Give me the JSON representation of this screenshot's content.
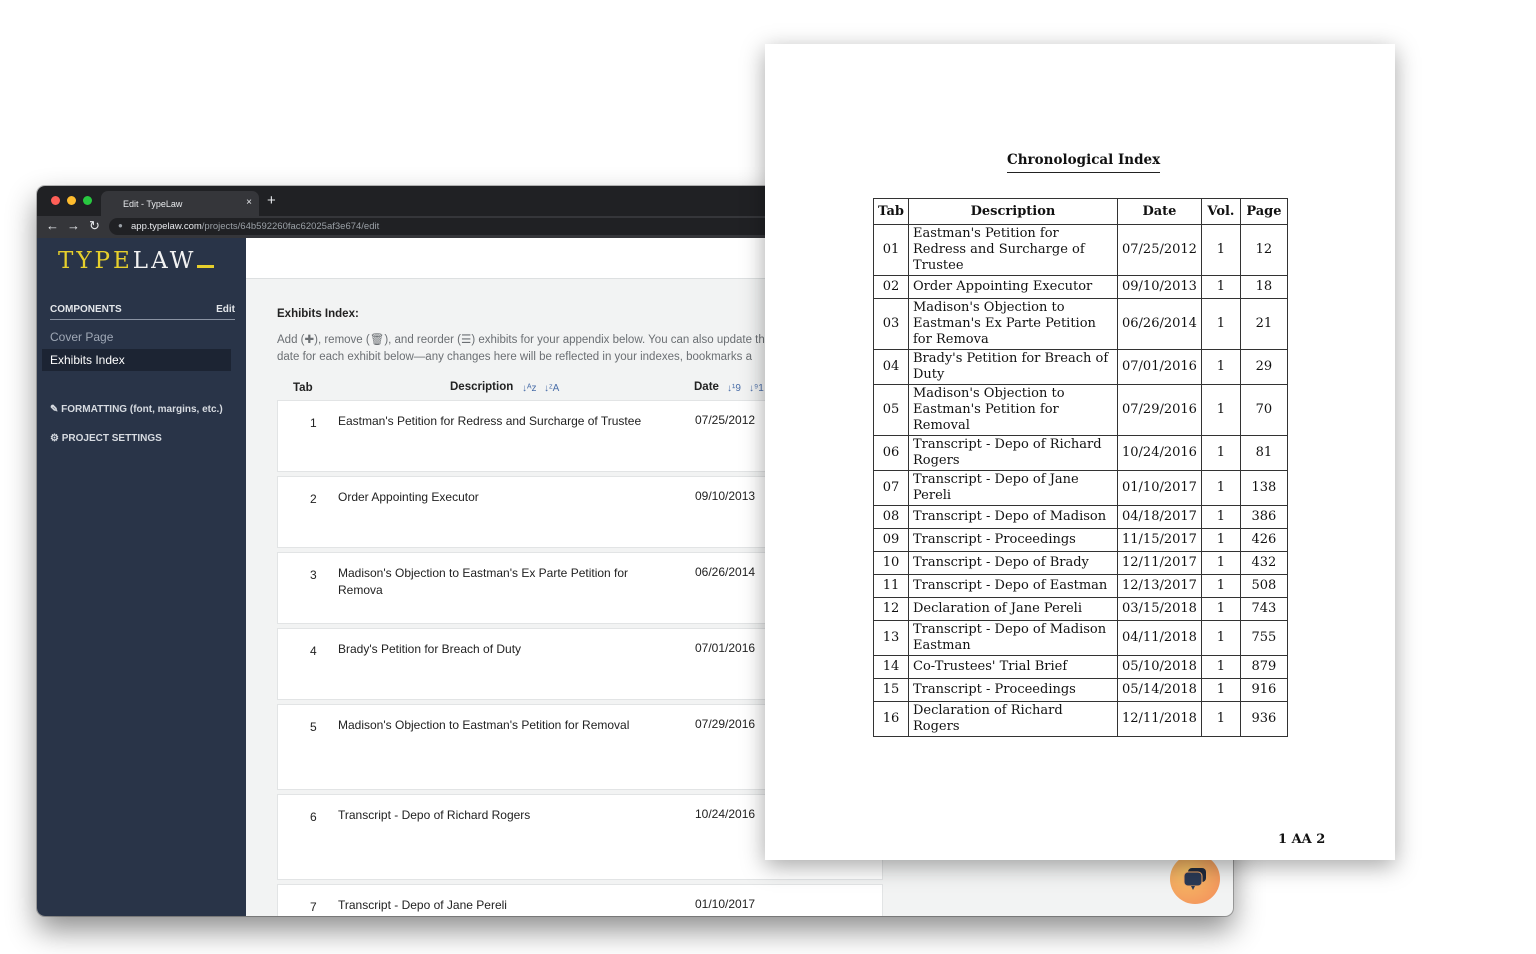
{
  "browser": {
    "tab_title": "Edit - TypeLaw",
    "tab_close": "×",
    "new_tab": "+",
    "url_host": "app.typelaw.com",
    "url_path": "/projects/64b592260fac62025af3e674/edit",
    "nav": {
      "back": "←",
      "forward": "→",
      "reload": "↻",
      "lock": "🔒"
    }
  },
  "sidebar": {
    "logo_type": "TYPE",
    "logo_law": "LAW",
    "components_label": "COMPONENTS",
    "edit_label": "Edit",
    "items": [
      {
        "label": "Cover Page",
        "active": false
      },
      {
        "label": "Exhibits Index",
        "active": true
      }
    ],
    "formatting_label": "FORMATTING (font, margins, etc.)",
    "project_settings_label": "PROJECT SETTINGS",
    "formatting_icon": "✎",
    "settings_icon": "⚙"
  },
  "main": {
    "title": "Exhibits Index:",
    "desc_line1": "Add (✚), remove (🗑), and reorder (☰) exhibits for your appendix below. You can also update th",
    "desc_line2": "date for each exhibit below—any changes here will be reflected in your indexes, bookmarks a",
    "columns": {
      "tab": "Tab",
      "description": "Description",
      "date": "Date"
    },
    "sort_icons": {
      "desc_az": "↓ᴬz",
      "desc_za": "↓ᶻA",
      "date_19": "↓¹9",
      "date_91": "↓⁹1"
    },
    "exhibits": [
      {
        "num": "1",
        "description": "Eastman's Petition for Redress and Surcharge of Trustee",
        "date": "07/25/2012"
      },
      {
        "num": "2",
        "description": "Order Appointing Executor",
        "date": "09/10/2013"
      },
      {
        "num": "3",
        "description": "Madison's Objection to Eastman's Ex Parte Petition for Remova",
        "date": "06/26/2014"
      },
      {
        "num": "4",
        "description": "Brady's Petition for Breach of Duty",
        "date": "07/01/2016"
      },
      {
        "num": "5",
        "description": "Madison's Objection to Eastman's Petition for Removal",
        "date": "07/29/2016"
      },
      {
        "num": "6",
        "description": "Transcript - Depo of Richard Rogers",
        "date": "10/24/2016"
      },
      {
        "num": "7",
        "description": "Transcript - Depo of Jane Pereli",
        "date": "01/10/2017"
      }
    ],
    "chat_icon": "chat-bubbles"
  },
  "document": {
    "title": "Chronological Index",
    "headers": [
      "Tab",
      "Description",
      "Date",
      "Vol.",
      "Page"
    ],
    "rows": [
      {
        "tab": "01",
        "description": "Eastman's Petition for Redress and Surcharge of Trustee",
        "date": "07/25/2012",
        "vol": "1",
        "page": "12"
      },
      {
        "tab": "02",
        "description": "Order Appointing Executor",
        "date": "09/10/2013",
        "vol": "1",
        "page": "18"
      },
      {
        "tab": "03",
        "description": "Madison's Objection to Eastman's Ex Parte Petition for Remova",
        "date": "06/26/2014",
        "vol": "1",
        "page": "21"
      },
      {
        "tab": "04",
        "description": "Brady's Petition for Breach of Duty",
        "date": "07/01/2016",
        "vol": "1",
        "page": "29"
      },
      {
        "tab": "05",
        "description": "Madison's Objection to Eastman's Petition for Removal",
        "date": "07/29/2016",
        "vol": "1",
        "page": "70"
      },
      {
        "tab": "06",
        "description": "Transcript - Depo of Richard Rogers",
        "date": "10/24/2016",
        "vol": "1",
        "page": "81"
      },
      {
        "tab": "07",
        "description": "Transcript - Depo of Jane Pereli",
        "date": "01/10/2017",
        "vol": "1",
        "page": "138"
      },
      {
        "tab": "08",
        "description": "Transcript - Depo of Madison",
        "date": "04/18/2017",
        "vol": "1",
        "page": "386"
      },
      {
        "tab": "09",
        "description": "Transcript - Proceedings",
        "date": "11/15/2017",
        "vol": "1",
        "page": "426"
      },
      {
        "tab": "10",
        "description": "Transcript - Depo of Brady",
        "date": "12/11/2017",
        "vol": "1",
        "page": "432"
      },
      {
        "tab": "11",
        "description": "Transcript - Depo of Eastman",
        "date": "12/13/2017",
        "vol": "1",
        "page": "508"
      },
      {
        "tab": "12",
        "description": "Declaration of Jane Pereli",
        "date": "03/15/2018",
        "vol": "1",
        "page": "743"
      },
      {
        "tab": "13",
        "description": "Transcript - Depo of Madison Eastman",
        "date": "04/11/2018",
        "vol": "1",
        "page": "755"
      },
      {
        "tab": "14",
        "description": "Co-Trustees' Trial Brief",
        "date": "05/10/2018",
        "vol": "1",
        "page": "879"
      },
      {
        "tab": "15",
        "description": "Transcript - Proceedings",
        "date": "05/14/2018",
        "vol": "1",
        "page": "916"
      },
      {
        "tab": "16",
        "description": "Declaration of Richard Rogers",
        "date": "12/11/2018",
        "vol": "1",
        "page": "936"
      }
    ],
    "footer": "1 AA 2"
  },
  "colors": {
    "sidebar_bg": "#293448",
    "logo_accent": "#e6cf2c",
    "sort_icon": "#4a6ea8",
    "chat_gradient_start": "#f5c267",
    "chat_gradient_end": "#f48b5a",
    "traffic_red": "#ff5f57",
    "traffic_yellow": "#febc2e",
    "traffic_green": "#28c840"
  }
}
